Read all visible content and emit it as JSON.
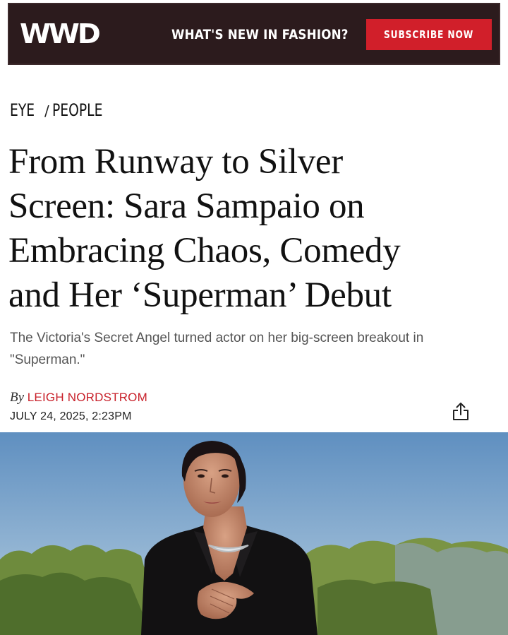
{
  "header": {
    "logo": "WWD",
    "cta_text": "WHAT'S NEW IN FASHION?",
    "subscribe_label": "SUBSCRIBE NOW",
    "colors": {
      "bar": "#2c1b1d",
      "subscribe": "#d11f2a"
    }
  },
  "breadcrumb": {
    "items": [
      "EYE",
      "PEOPLE"
    ],
    "separator": "/"
  },
  "article": {
    "title_lines": [
      "From Runway to Silver",
      "Screen: Sara Sampaio on",
      "Embracing Chaos, Comedy",
      "and Her ‘Superman’ Debut"
    ],
    "dek": "The Victoria's Secret Angel turned actor on her big-screen breakout in \"Superman.\"",
    "by_prefix": "By",
    "author": "LEIGH NORDSTROM",
    "date": "JULY 24, 2025, 2:23PM",
    "share_icon": "share-icon",
    "accent_color": "#c8202a"
  },
  "hero_image": {
    "subject": "woman in black blazer with silver necklace, blue sky, green shrubs"
  }
}
